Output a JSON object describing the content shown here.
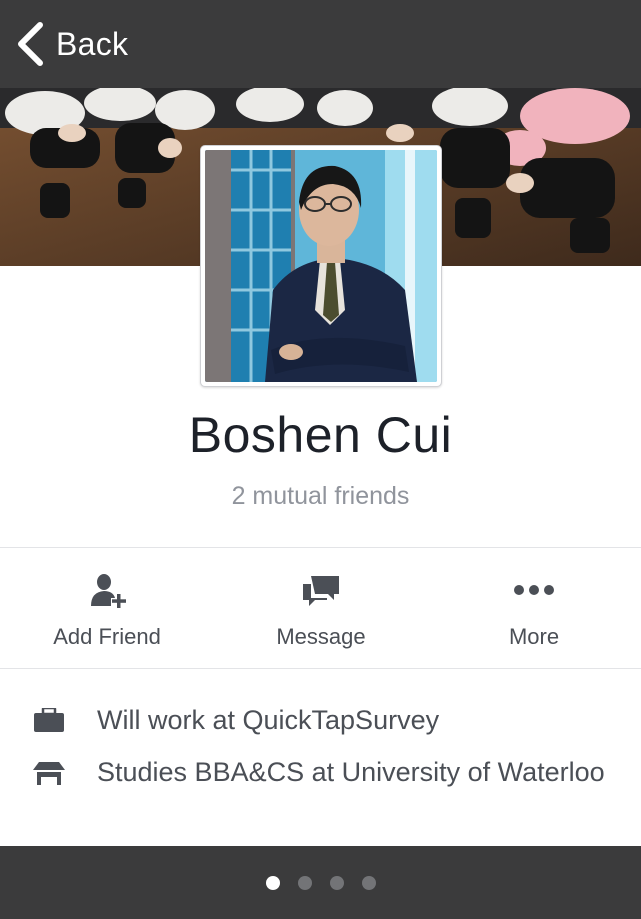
{
  "nav": {
    "back_label": "Back"
  },
  "profile": {
    "name": "Boshen Cui",
    "mutual_friends": "2 mutual friends"
  },
  "actions": [
    {
      "label": "Add Friend",
      "icon": "add-friend-icon"
    },
    {
      "label": "Message",
      "icon": "message-icon"
    },
    {
      "label": "More",
      "icon": "more-icon"
    }
  ],
  "info": [
    {
      "text": "Will work at QuickTapSurvey",
      "icon": "briefcase-icon"
    },
    {
      "text": "Studies BBA&CS at University of Waterloo",
      "icon": "school-icon"
    }
  ],
  "pager": {
    "count": 4,
    "active_index": 0
  },
  "colors": {
    "bar": "#3b3b3c",
    "name_text": "#1d2129",
    "secondary_text": "#90949c",
    "icon": "#4b4f56"
  }
}
